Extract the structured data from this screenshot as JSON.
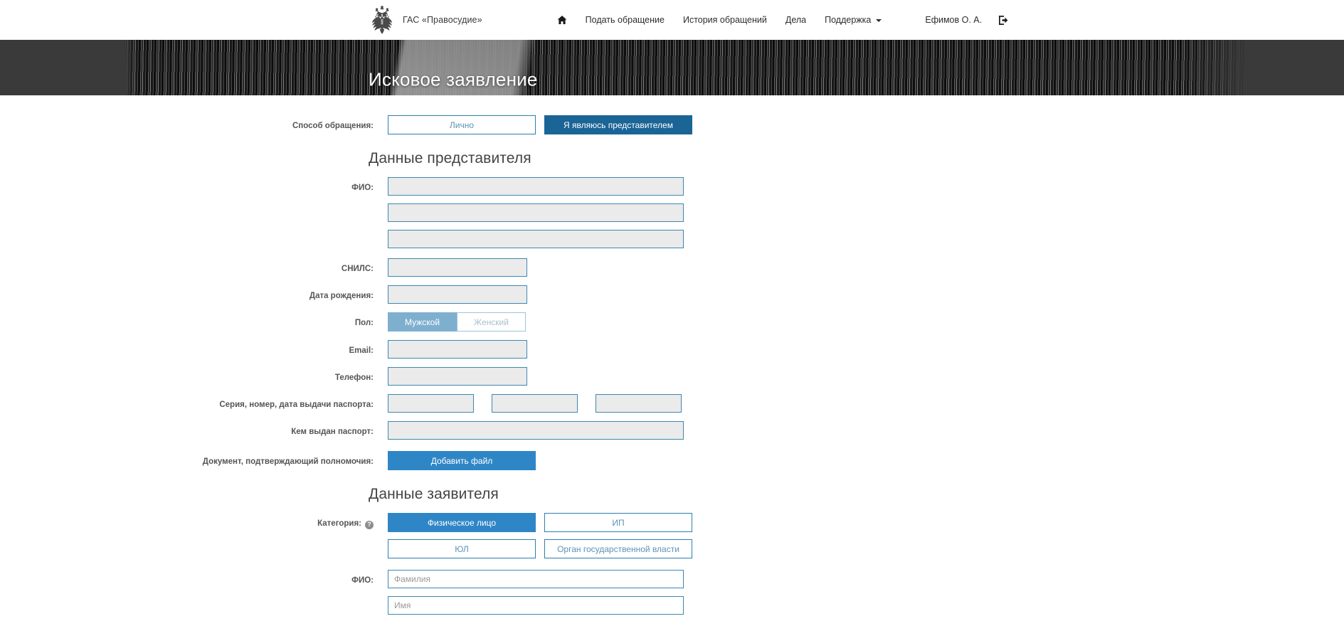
{
  "header": {
    "brand_title": "ГАС «Правосудие»",
    "brand_emblem_icon": "russian-coat-of-arms",
    "nav": [
      {
        "label": "",
        "icon": "home-icon",
        "has_caret": false
      },
      {
        "label": "Подать обращение",
        "icon": "",
        "has_caret": false
      },
      {
        "label": "История обращений",
        "icon": "",
        "has_caret": false
      },
      {
        "label": "Дела",
        "icon": "",
        "has_caret": false
      },
      {
        "label": "Поддержка",
        "icon": "",
        "has_caret": true
      }
    ],
    "user_name": "Ефимов О. А.",
    "logout_icon": "logout-icon"
  },
  "hero": {
    "title": "Исковое заявление"
  },
  "form": {
    "method_row": {
      "label": "Способ обращения:",
      "options": [
        {
          "label": "Лично",
          "state": "inactive"
        },
        {
          "label": "Я являюсь представителем",
          "state": "active"
        }
      ]
    },
    "representative_section": {
      "heading": "Данные представителя",
      "fio": {
        "label": "ФИО:",
        "values": [
          "",
          "",
          ""
        ],
        "placeholders": [
          "",
          "",
          ""
        ]
      },
      "snils": {
        "label": "СНИЛС:",
        "value": "",
        "placeholder": ""
      },
      "birthdate": {
        "label": "Дата рождения:",
        "value": "",
        "placeholder": ""
      },
      "gender": {
        "label": "Пол:",
        "options": [
          {
            "label": "Мужской",
            "state": "selected-muted"
          },
          {
            "label": "Женский",
            "state": "ghost"
          }
        ]
      },
      "email": {
        "label": "Email:",
        "value": "",
        "placeholder": ""
      },
      "phone": {
        "label": "Телефон:",
        "value": "",
        "placeholder": ""
      },
      "passport": {
        "label": "Серия, номер, дата выдачи паспорта:",
        "values": [
          "",
          "",
          ""
        ],
        "placeholders": [
          "",
          "",
          ""
        ]
      },
      "passport_issuer": {
        "label": "Кем выдан паспорт:",
        "value": "",
        "placeholder": ""
      },
      "authority_doc": {
        "label": "Документ, подтверждающий полномочия:",
        "button_label": "Добавить файл"
      }
    },
    "applicant_section": {
      "heading": "Данные заявителя",
      "category": {
        "label": "Категория:",
        "help_icon": "question-mark-icon",
        "help_glyph": "?",
        "options": [
          {
            "label": "Физическое лицо",
            "state": "active"
          },
          {
            "label": "ИП",
            "state": "inactive"
          },
          {
            "label": "ЮЛ",
            "state": "inactive"
          },
          {
            "label": "Орган государственной власти",
            "state": "inactive"
          }
        ]
      },
      "fio": {
        "label": "ФИО:",
        "values": [
          "",
          ""
        ],
        "placeholders": [
          "Фамилия",
          "Имя"
        ]
      }
    }
  },
  "colors": {
    "accent_dark_blue": "#1a6496",
    "accent_bright_blue": "#2f86c6",
    "accent_muted_blue": "#7eafcf",
    "input_border": "#3d87b0",
    "input_disabled_bg": "#ebebeb",
    "hero_bg": "#3a3a3a",
    "label_text": "#555555",
    "heading_text": "#444444"
  }
}
